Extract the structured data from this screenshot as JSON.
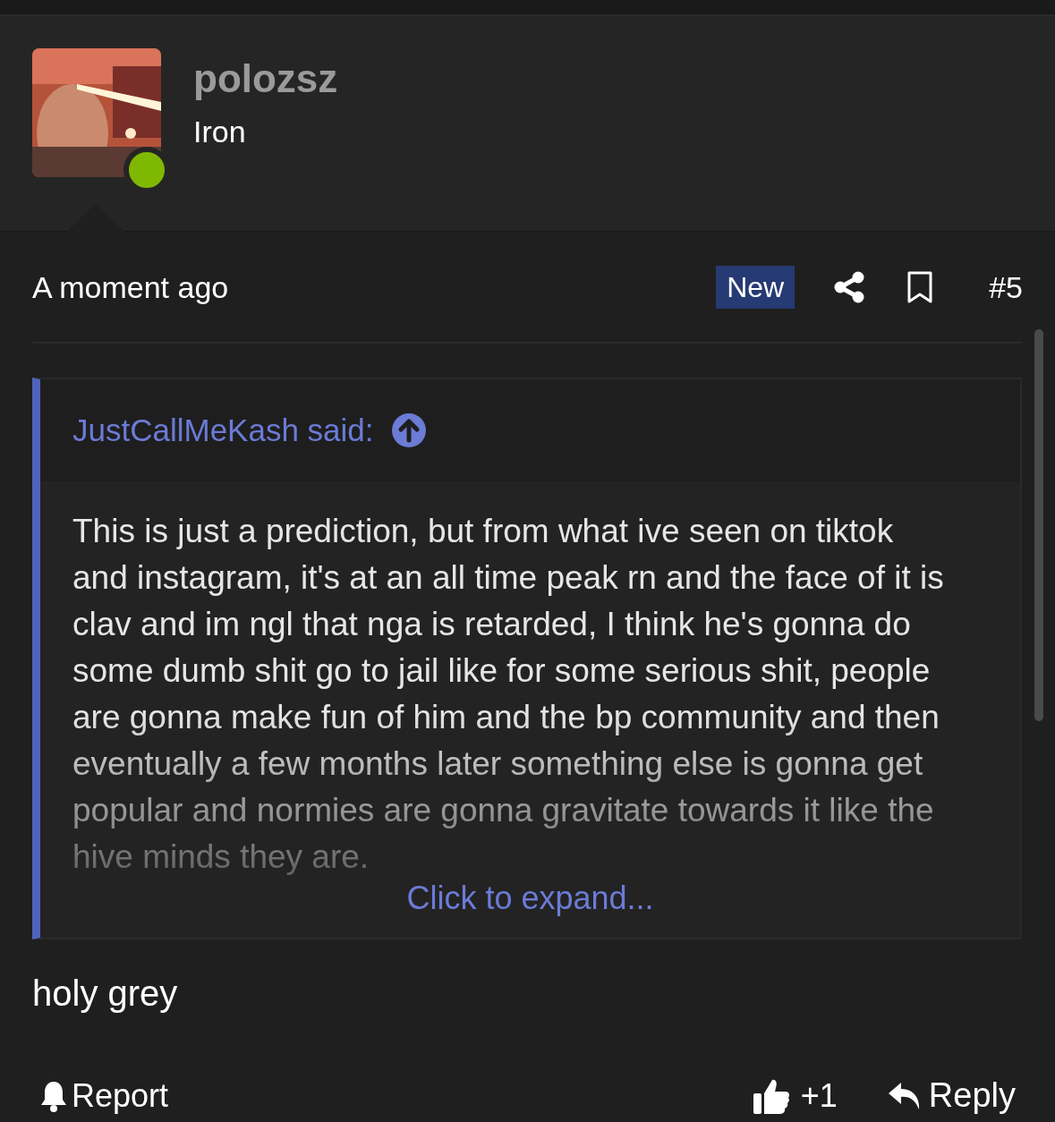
{
  "author": {
    "name": "polozsz",
    "rank": "Iron",
    "online": true
  },
  "post": {
    "time": "A moment ago",
    "badge": "New",
    "number": "#5",
    "bookmarked": false
  },
  "quote": {
    "author": "JustCallMeKash said:",
    "text": "This is just a prediction, but from what ive seen on tiktok and instagram, it's at an all time peak rn and the face of it is clav and im ngl that nga is retarded, I think he's gonna do some dumb shit go to jail like for some serious shit, people are gonna make fun of him and the bp community and then eventually a few months later something else is gonna get popular and normies are gonna gravitate towards it like the hive minds they are.",
    "expand": "Click to expand..."
  },
  "message": "holy grey",
  "actions": {
    "report": "Report",
    "likes": "+1",
    "reply": "Reply"
  }
}
